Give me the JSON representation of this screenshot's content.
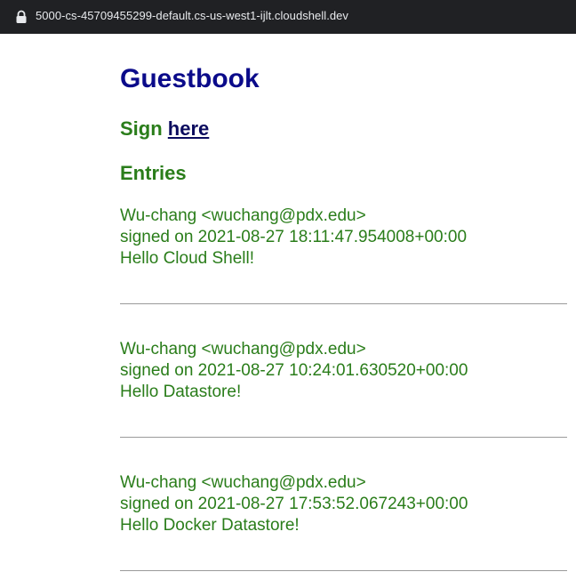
{
  "browser": {
    "url": "5000-cs-45709455299-default.cs-us-west1-ijlt.cloudshell.dev"
  },
  "page": {
    "title": "Guestbook",
    "sign_prefix": "Sign",
    "sign_link": "here",
    "entries_heading": "Entries",
    "entries": [
      {
        "author": "Wu-chang <wuchang@pdx.edu>",
        "signed": "signed on 2021-08-27 18:11:47.954008+00:00",
        "message": "Hello Cloud Shell!"
      },
      {
        "author": "Wu-chang <wuchang@pdx.edu>",
        "signed": "signed on 2021-08-27 10:24:01.630520+00:00",
        "message": "Hello Datastore!"
      },
      {
        "author": "Wu-chang <wuchang@pdx.edu>",
        "signed": "signed on 2021-08-27 17:53:52.067243+00:00",
        "message": "Hello Docker Datastore!"
      }
    ]
  }
}
